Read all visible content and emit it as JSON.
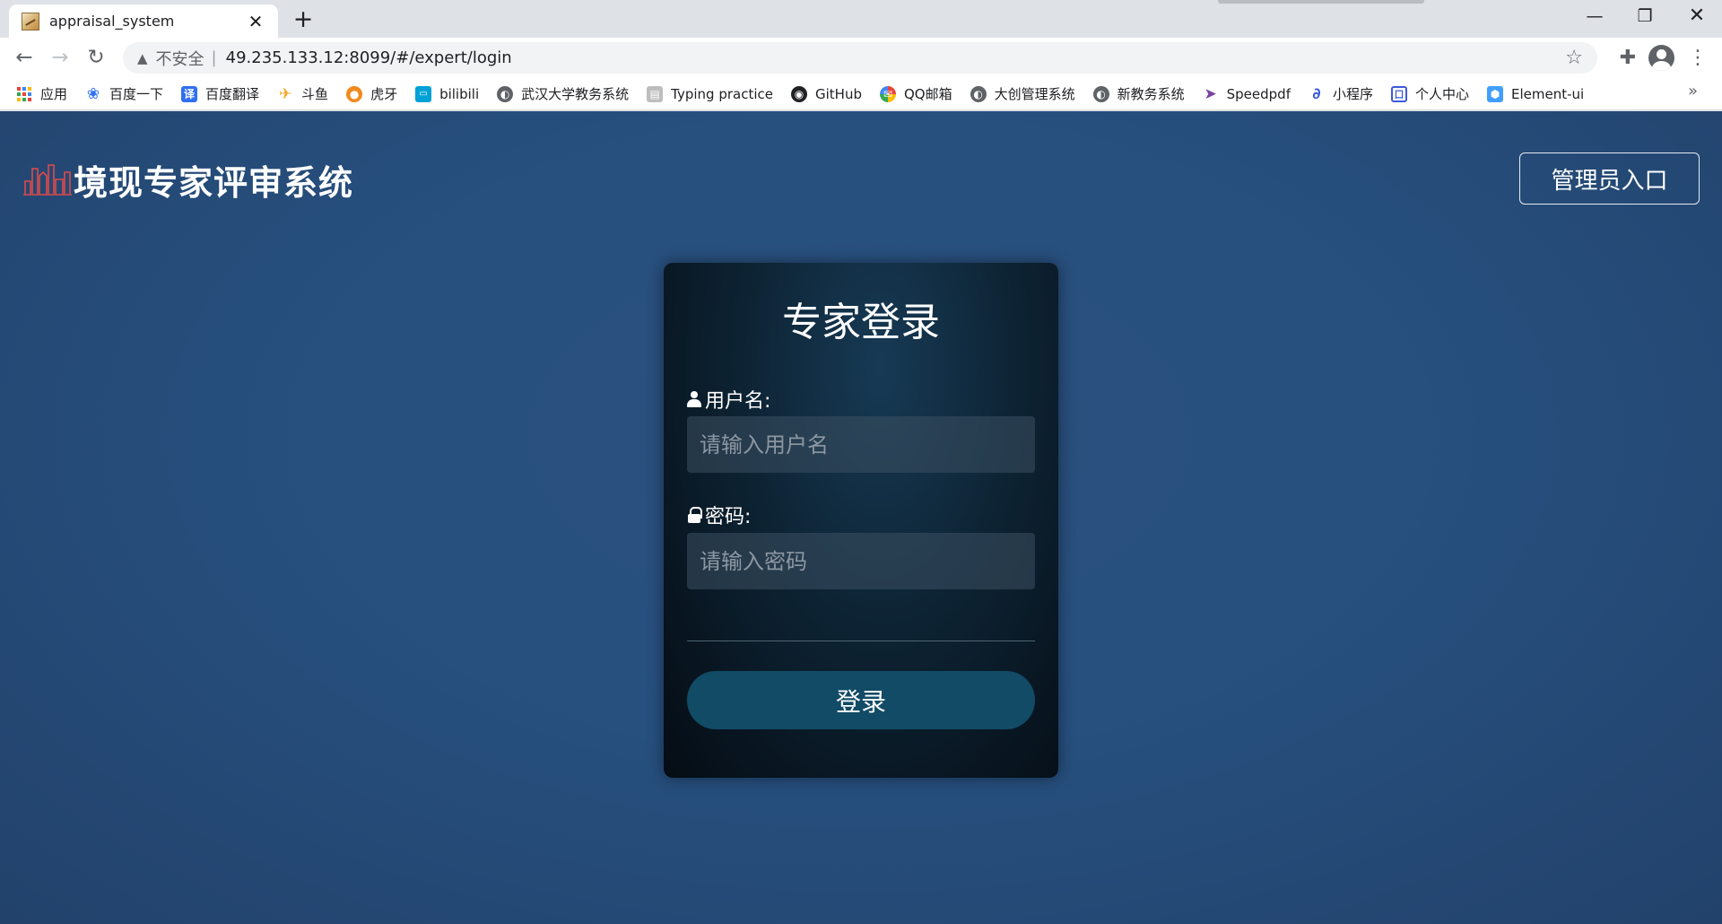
{
  "browser": {
    "tab_title": "appraisal_system",
    "tab_close": "✕",
    "new_tab": "+",
    "win_min": "—",
    "win_max": "❐",
    "win_close": "✕",
    "insecure_label": "不安全",
    "separator": "|",
    "url": "49.235.133.12:8099/#/expert/login",
    "bookmarks": [
      {
        "label": "应用",
        "icon": "apps-grid-icon"
      },
      {
        "label": "百度一下",
        "icon": "baidu-paw-icon",
        "color": "#2f6ff0"
      },
      {
        "label": "百度翻译",
        "icon": "baidu-translate-icon",
        "color": "#2f6ff0"
      },
      {
        "label": "斗鱼",
        "icon": "douyu-icon",
        "color": "#f5a623"
      },
      {
        "label": "虎牙",
        "icon": "huya-icon",
        "color": "#f08a1c"
      },
      {
        "label": "bilibili",
        "icon": "bilibili-icon",
        "color": "#00a1d6"
      },
      {
        "label": "武汉大学教务系统",
        "icon": "globe-icon",
        "color": "#5f6368"
      },
      {
        "label": "Typing practice",
        "icon": "typing-icon",
        "color": "#9e9e9e"
      },
      {
        "label": "GitHub",
        "icon": "github-icon",
        "color": "#202124"
      },
      {
        "label": "QQ邮箱",
        "icon": "qqmail-icon",
        "color": "#f4b400"
      },
      {
        "label": "大创管理系统",
        "icon": "globe-icon",
        "color": "#5f6368"
      },
      {
        "label": "新教务系统",
        "icon": "globe-icon",
        "color": "#5f6368"
      },
      {
        "label": "Speedpdf",
        "icon": "speedpdf-icon",
        "color": "#7b3fa0"
      },
      {
        "label": "小程序",
        "icon": "miniprogram-icon",
        "color": "#3b5bdb"
      },
      {
        "label": "个人中心",
        "icon": "personal-center-icon",
        "color": "#3b5bdb"
      },
      {
        "label": "Element-ui",
        "icon": "element-ui-icon",
        "color": "#409eff"
      }
    ],
    "bookmarks_more": "»"
  },
  "page": {
    "brand_title": "境现专家评审系统",
    "admin_button": "管理员入口",
    "login": {
      "title": "专家登录",
      "username_label": "用户名:",
      "username_placeholder": "请输入用户名",
      "password_label": "密码:",
      "password_placeholder": "请输入密码",
      "submit_label": "登录"
    }
  },
  "colors": {
    "page_bg": "#27507f",
    "card_bg": "#0d2333",
    "login_button": "#114b66",
    "logo_red": "#e04a4a"
  }
}
